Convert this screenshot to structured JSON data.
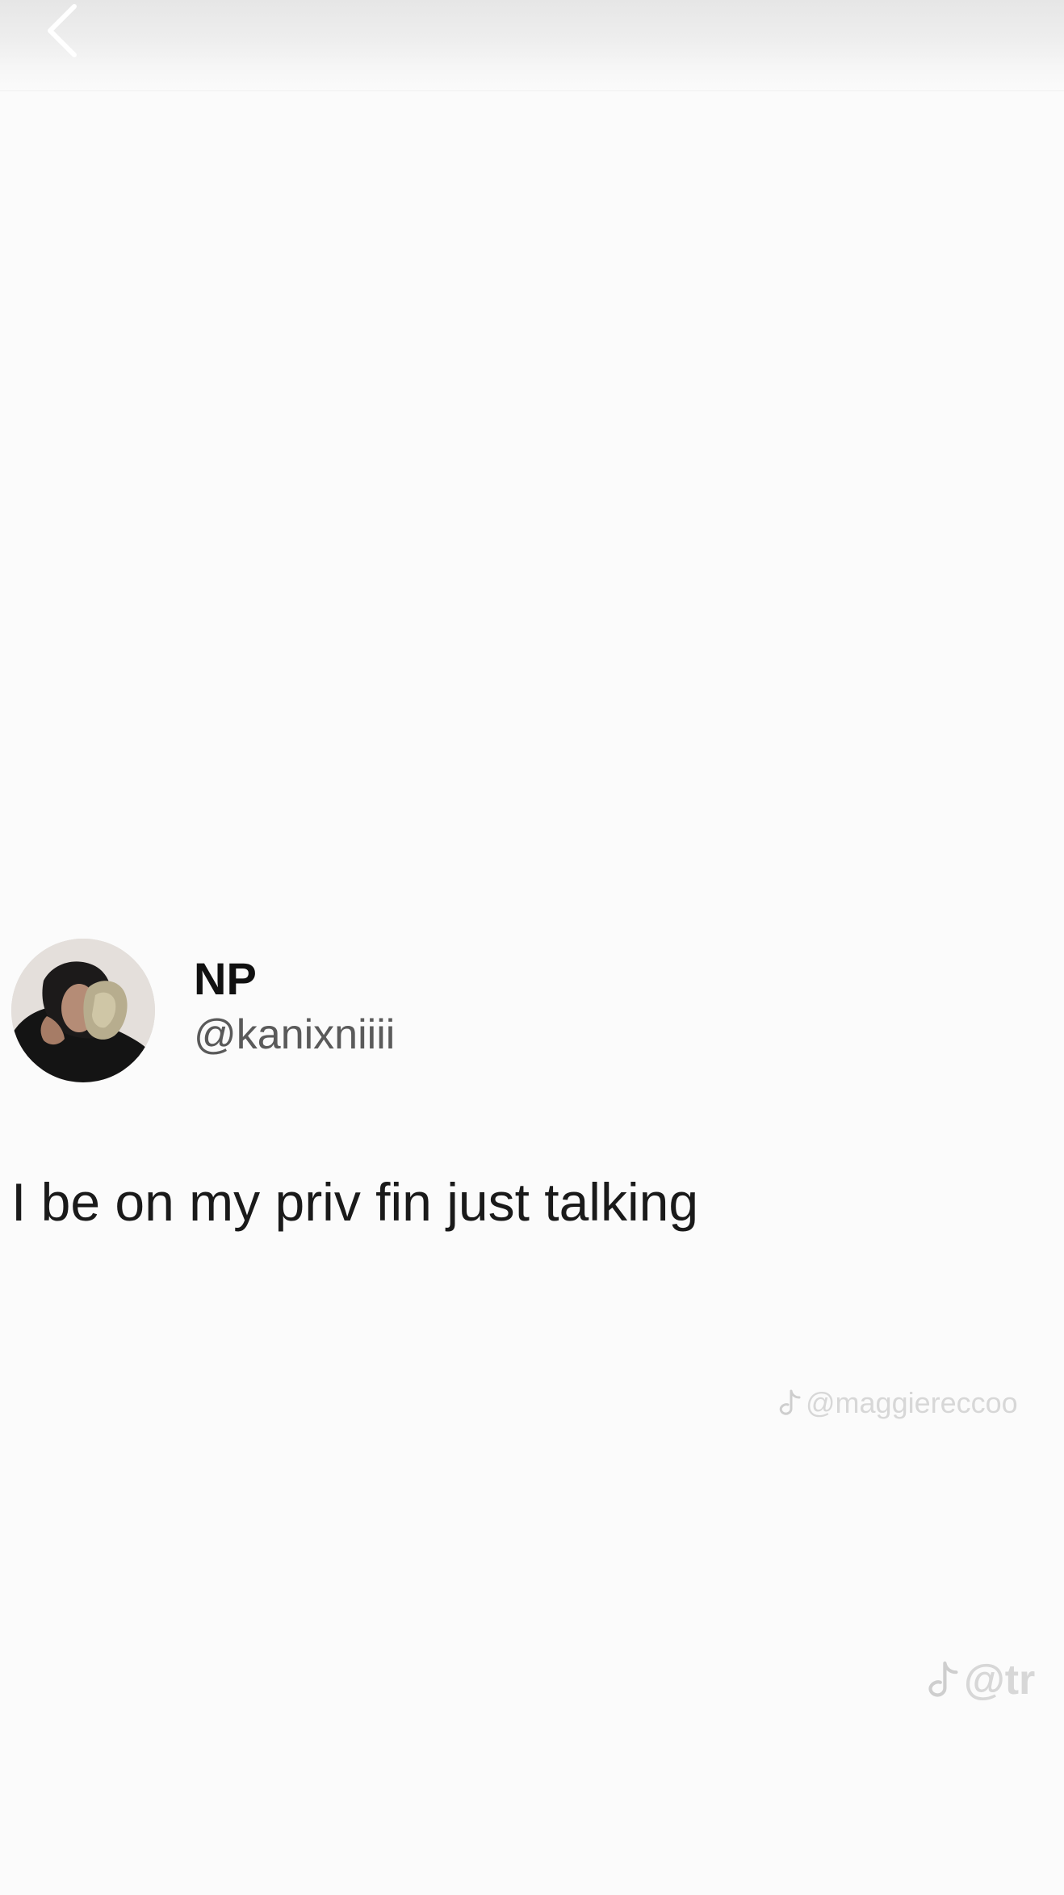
{
  "header": {
    "back_icon": "chevron-left-icon"
  },
  "tweet": {
    "display_name": "NP",
    "handle": "@kanixniiii",
    "text": "I be on my priv fin just talking",
    "avatar_icon": "profile-photo"
  },
  "watermarks": [
    {
      "icon": "tiktok-icon",
      "text": "@maggiereccoo"
    },
    {
      "icon": "tiktok-icon",
      "text": "@tr"
    }
  ]
}
